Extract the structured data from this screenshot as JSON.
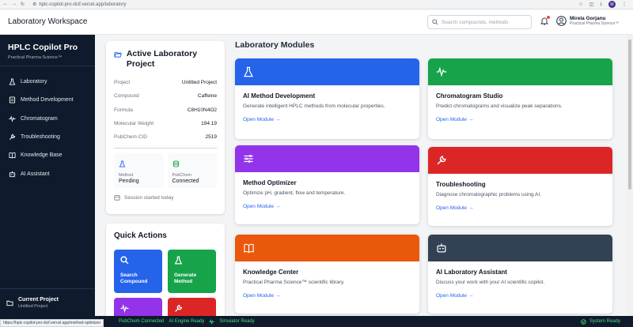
{
  "browser": {
    "url": "hplc-copilot-pro-dcif.vercel.app/laboratory",
    "profile_initial": "M",
    "hover_url": "https://hplc-copilot-pro-dcif.vercel.app/method-optimizer"
  },
  "header": {
    "title": "Laboratory Workspace",
    "search_placeholder": "Search compounds, methods",
    "user_name": "Mirela Gorjanu",
    "user_org": "Practical Pharma Science™"
  },
  "sidebar": {
    "brand": "HPLC Copilot Pro",
    "tagline": "Practical Pharma Science™",
    "items": [
      {
        "label": "Laboratory",
        "icon": "flask-icon"
      },
      {
        "label": "Method Development",
        "icon": "document-icon"
      },
      {
        "label": "Chromatogram",
        "icon": "waveform-icon"
      },
      {
        "label": "Troubleshooting",
        "icon": "wrench-icon"
      },
      {
        "label": "Knowledge Base",
        "icon": "book-icon"
      },
      {
        "label": "AI Assistant",
        "icon": "robot-icon"
      }
    ],
    "current_label": "Current Project",
    "current_value": "Untitled Project"
  },
  "project": {
    "title": "Active Laboratory Project",
    "rows": [
      {
        "k": "Project",
        "v": "Untitled Project"
      },
      {
        "k": "Compound",
        "v": "Caffeine"
      },
      {
        "k": "Formula",
        "v": "C8H10N4O2"
      },
      {
        "k": "Molecular Weight",
        "v": "194.19"
      },
      {
        "k": "PubChem CID",
        "v": "2519"
      }
    ],
    "method_label": "Method",
    "method_value": "Pending",
    "pubchem_label": "PubChem",
    "pubchem_value": "Connected",
    "session": "Session started today"
  },
  "quick_actions": {
    "title": "Quick Actions",
    "search_label": "Search Compound",
    "generate_label": "Generate Method"
  },
  "modules": {
    "title": "Laboratory Modules",
    "open_label": "Open Module →",
    "items": [
      {
        "title": "AI Method Development",
        "desc": "Generate intelligent HPLC methods from molecular properties.",
        "color": "#2563eb"
      },
      {
        "title": "Chromatogram Studio",
        "desc": "Predict chromatograms and visualize peak separations.",
        "color": "#16a34a"
      },
      {
        "title": "Method Optimizer",
        "desc": "Optimize pH, gradient, flow and temperature.",
        "color": "#9333ea"
      },
      {
        "title": "Troubleshooting",
        "desc": "Diagnose chromatographic problems using AI.",
        "color": "#dc2626"
      },
      {
        "title": "Knowledge Center",
        "desc": "Practical Pharma Science™ scientific library.",
        "color": "#ea580c"
      },
      {
        "title": "AI Laboratory Assistant",
        "desc": "Discuss your work with your AI scientific copilot.",
        "color": "#334155"
      }
    ]
  },
  "status": {
    "pubchem": "PubChem Connected",
    "ai": "AI Engine Ready",
    "simulator": "Simulator Ready",
    "system": "System Ready"
  }
}
